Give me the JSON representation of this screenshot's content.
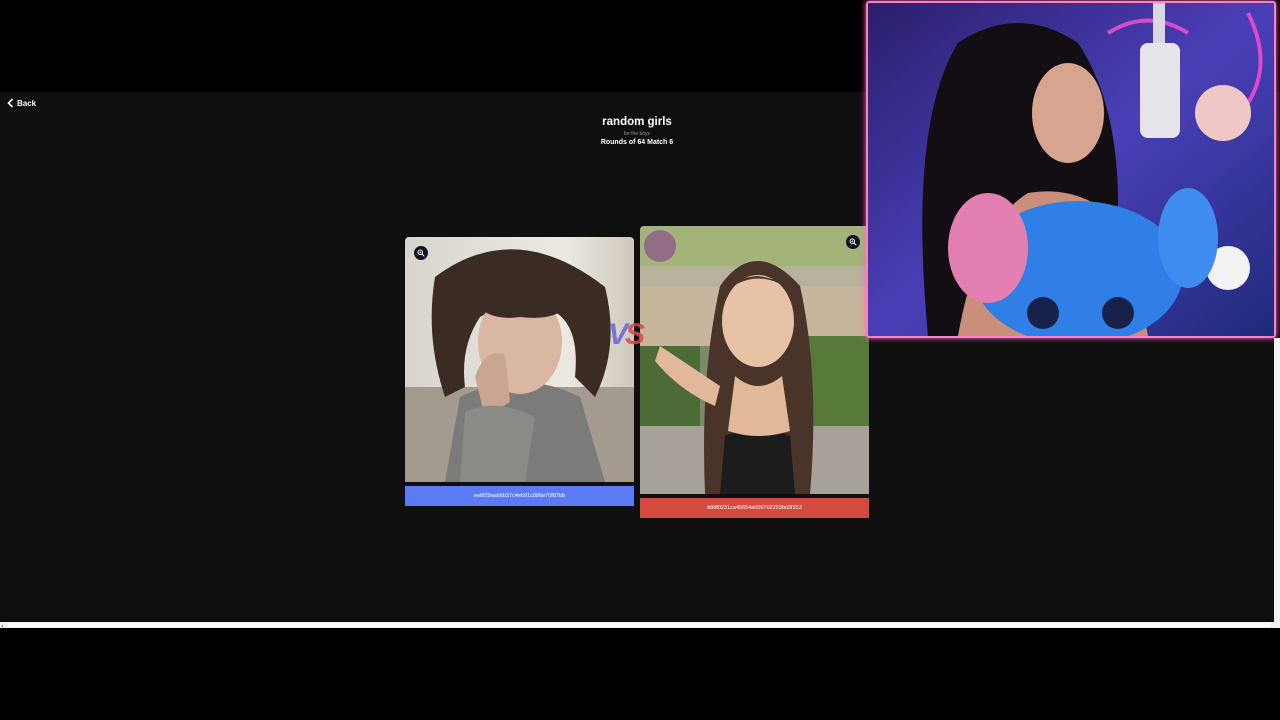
{
  "nav": {
    "back_label": "Back"
  },
  "header": {
    "title": "random girls",
    "subtitle": "for the boyz",
    "round_info": "Rounds of 64 Match 6"
  },
  "matchup": {
    "vs_label": "VS",
    "left": {
      "name": "ee8f29aab6b37c4eb91c086e70f87bb",
      "bar_color": "#5b7bf5"
    },
    "right": {
      "name": "b8df0231ca45654a000702253bd3f253",
      "bar_color": "#d34b3f"
    }
  },
  "icons": {
    "back": "chevron-left-icon",
    "zoom": "zoom-in-icon"
  },
  "colors": {
    "page_bg": "#0f0f0f",
    "webcam_border": "#ff7fc7"
  }
}
